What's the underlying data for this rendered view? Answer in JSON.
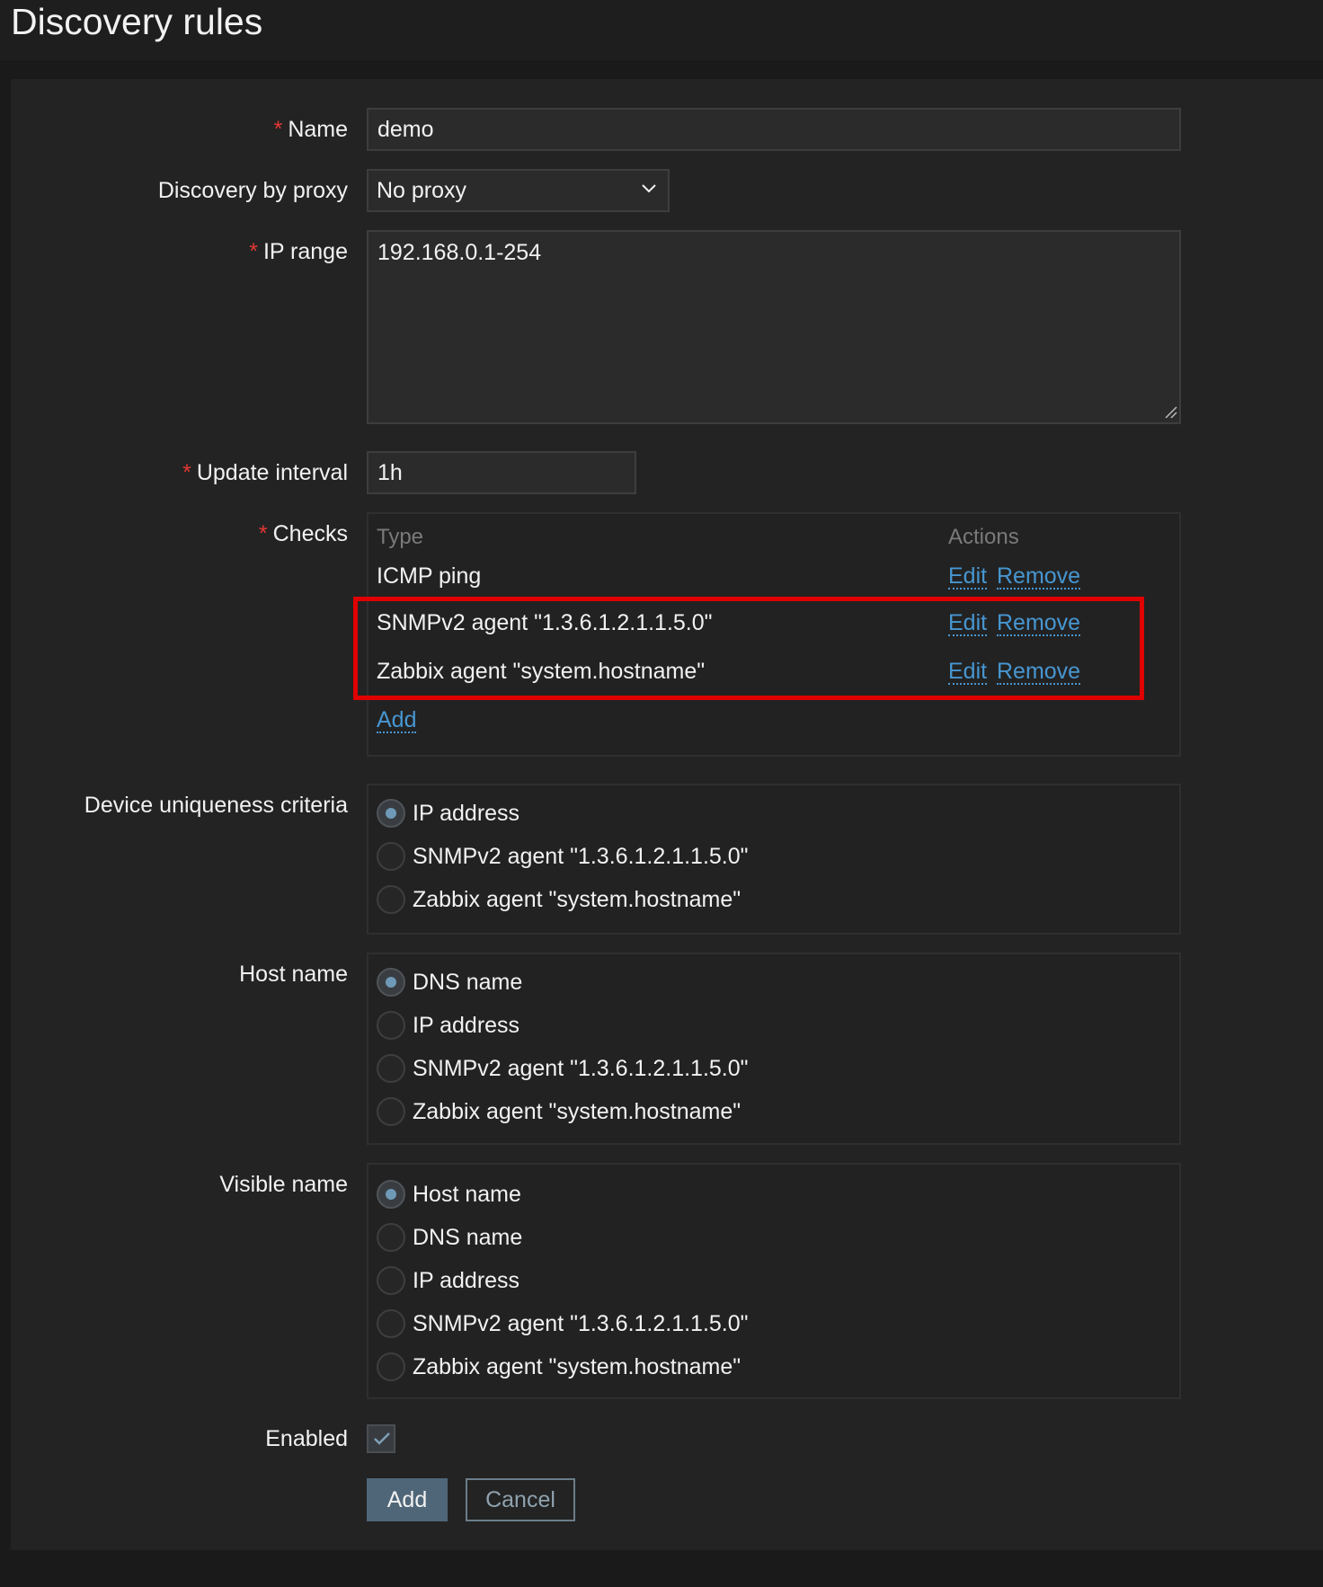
{
  "header": {
    "title": "Discovery rules"
  },
  "form": {
    "name": {
      "label": "Name",
      "required": "*",
      "value": "demo"
    },
    "proxy": {
      "label": "Discovery by proxy",
      "value": "No proxy"
    },
    "ip_range": {
      "label": "IP range",
      "required": "*",
      "value": "192.168.0.1-254"
    },
    "update_interval": {
      "label": "Update interval",
      "required": "*",
      "value": "1h"
    },
    "checks": {
      "label": "Checks",
      "required": "*",
      "col_type": "Type",
      "col_actions": "Actions",
      "rows": [
        {
          "type": "ICMP ping",
          "edit": "Edit",
          "remove": "Remove"
        },
        {
          "type": "SNMPv2 agent \"1.3.6.1.2.1.1.5.0\"",
          "edit": "Edit",
          "remove": "Remove"
        },
        {
          "type": "Zabbix agent \"system.hostname\"",
          "edit": "Edit",
          "remove": "Remove"
        }
      ],
      "add_label": "Add"
    },
    "uniqueness": {
      "label": "Device uniqueness criteria",
      "selected": "IP address",
      "options": [
        "IP address",
        "SNMPv2 agent \"1.3.6.1.2.1.1.5.0\"",
        "Zabbix agent \"system.hostname\""
      ]
    },
    "host_name": {
      "label": "Host name",
      "selected": "DNS name",
      "options": [
        "DNS name",
        "IP address",
        "SNMPv2 agent \"1.3.6.1.2.1.1.5.0\"",
        "Zabbix agent \"system.hostname\""
      ]
    },
    "visible_name": {
      "label": "Visible name",
      "selected": "Host name",
      "options": [
        "Host name",
        "DNS name",
        "IP address",
        "SNMPv2 agent \"1.3.6.1.2.1.1.5.0\"",
        "Zabbix agent \"system.hostname\""
      ]
    },
    "enabled": {
      "label": "Enabled",
      "checked": true
    },
    "buttons": {
      "add": "Add",
      "cancel": "Cancel"
    }
  },
  "colors": {
    "background": "#1a1a1a",
    "panel": "#232323",
    "link": "#4796d1",
    "required": "#e33734",
    "highlight": "#e00000",
    "primary_button": "#4f6678"
  },
  "icons": {
    "select": "chevron-down-icon",
    "checkbox": "check-icon",
    "textarea": "resize-grip-icon"
  }
}
